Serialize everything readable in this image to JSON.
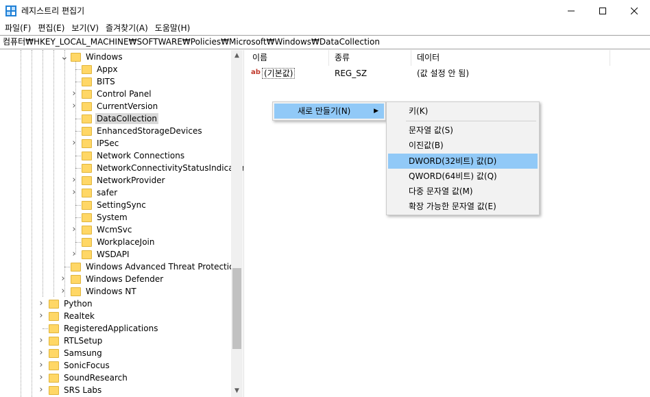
{
  "window": {
    "title": "레지스트리 편집기"
  },
  "menubar": [
    "파일(F)",
    "편집(E)",
    "보기(V)",
    "즐겨찾기(A)",
    "도움말(H)"
  ],
  "address": "컴퓨터₩HKEY_LOCAL_MACHINE₩SOFTWARE₩Policies₩Microsoft₩Windows₩DataCollection",
  "tree": {
    "windows_node": "Windows",
    "children": [
      {
        "label": "Appx",
        "expandable": false
      },
      {
        "label": "BITS",
        "expandable": false
      },
      {
        "label": "Control Panel",
        "expandable": true
      },
      {
        "label": "CurrentVersion",
        "expandable": true
      },
      {
        "label": "DataCollection",
        "expandable": false,
        "selected": true
      },
      {
        "label": "EnhancedStorageDevices",
        "expandable": false
      },
      {
        "label": "IPSec",
        "expandable": true
      },
      {
        "label": "Network Connections",
        "expandable": false
      },
      {
        "label": "NetworkConnectivityStatusIndicator",
        "expandable": false
      },
      {
        "label": "NetworkProvider",
        "expandable": true
      },
      {
        "label": "safer",
        "expandable": true
      },
      {
        "label": "SettingSync",
        "expandable": false
      },
      {
        "label": "System",
        "expandable": false
      },
      {
        "label": "WcmSvc",
        "expandable": true
      },
      {
        "label": "WorkplaceJoin",
        "expandable": false
      },
      {
        "label": "WSDAPI",
        "expandable": true
      }
    ],
    "siblings_level2": [
      {
        "label": "Windows Advanced Threat Protection",
        "expandable": false
      },
      {
        "label": "Windows Defender",
        "expandable": true
      },
      {
        "label": "Windows NT",
        "expandable": true
      }
    ],
    "siblings_level1": [
      {
        "label": "Python",
        "expandable": true
      },
      {
        "label": "Realtek",
        "expandable": true
      },
      {
        "label": "RegisteredApplications",
        "expandable": false
      },
      {
        "label": "RTLSetup",
        "expandable": true
      },
      {
        "label": "Samsung",
        "expandable": true
      },
      {
        "label": "SonicFocus",
        "expandable": true
      },
      {
        "label": "SoundResearch",
        "expandable": true
      },
      {
        "label": "SRS Labs",
        "expandable": true
      }
    ]
  },
  "list": {
    "columns": [
      "이름",
      "종류",
      "데이터"
    ],
    "rows": [
      {
        "name": "(기본값)",
        "type": "REG_SZ",
        "data": "(값 설정 안 됨)"
      }
    ]
  },
  "context_menu": {
    "new_label": "새로 만들기(N)",
    "submenu": [
      {
        "label": "키(K)",
        "highlighted": false
      },
      {
        "label": "문자열 값(S)",
        "highlighted": false
      },
      {
        "label": "이진값(B)",
        "highlighted": false
      },
      {
        "label": "DWORD(32비트) 값(D)",
        "highlighted": true
      },
      {
        "label": "QWORD(64비트) 값(Q)",
        "highlighted": false
      },
      {
        "label": "다중 문자열 값(M)",
        "highlighted": false
      },
      {
        "label": "확장 가능한 문자열 값(E)",
        "highlighted": false
      }
    ]
  },
  "colors": {
    "highlight": "#91c9f7",
    "selected_tree": "#d9d9d9",
    "folder": "#ffd766"
  }
}
